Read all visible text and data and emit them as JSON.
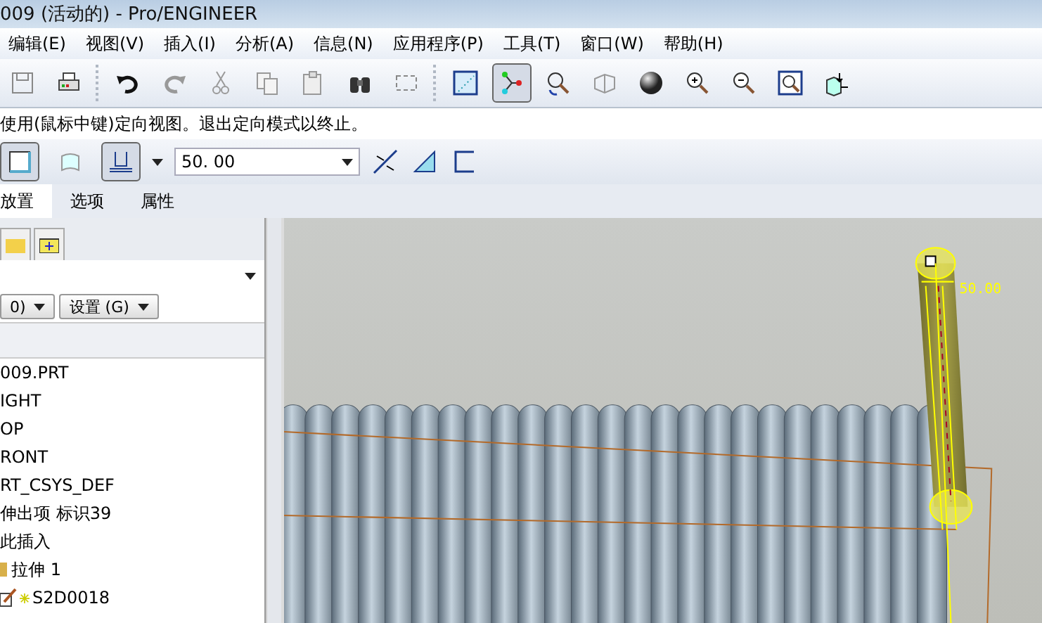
{
  "window": {
    "title": "009 (活动的) - Pro/ENGINEER"
  },
  "menu": [
    "编辑(E)",
    "视图(V)",
    "插入(I)",
    "分析(A)",
    "信息(N)",
    "应用程序(P)",
    "工具(T)",
    "窗口(W)",
    "帮助(H)"
  ],
  "toolbar": [
    [
      {
        "kind": "save"
      },
      {
        "kind": "print"
      }
    ],
    [
      {
        "kind": "undo"
      },
      {
        "kind": "redo"
      },
      {
        "kind": "cut"
      },
      {
        "kind": "copy"
      },
      {
        "kind": "paste"
      },
      {
        "kind": "find"
      },
      {
        "kind": "select"
      }
    ],
    [
      {
        "kind": "datum"
      },
      {
        "kind": "axes",
        "on": true
      },
      {
        "kind": "spin"
      },
      {
        "kind": "wire"
      },
      {
        "kind": "shade"
      },
      {
        "kind": "zoomin"
      },
      {
        "kind": "zoomout"
      },
      {
        "kind": "fit"
      },
      {
        "kind": "view"
      }
    ]
  ],
  "message": "使用(鼠标中键)定向视图。退出定向模式以终止。",
  "dashboard": {
    "solid_selected": true,
    "thicken_selected": false,
    "depth_selected": true,
    "depth_value": "50. 00"
  },
  "tabs": [
    {
      "label": "放置",
      "selected": true
    },
    {
      "label": "选项",
      "selected": false
    },
    {
      "label": "属性",
      "selected": false
    }
  ],
  "sidebar": {
    "buttons": [
      "0)",
      "设置 (G)"
    ],
    "tree": [
      {
        "label": "009.PRT",
        "children": [
          {
            "label": "IGHT"
          },
          {
            "label": "OP"
          },
          {
            "label": "RONT"
          },
          {
            "label": "RT_CSYS_DEF"
          },
          {
            "label": "伸出项 标识39"
          },
          {
            "label": "此插入"
          },
          {
            "label": "拉伸 1",
            "children": [
              {
                "label": "S2D0018"
              }
            ]
          }
        ]
      }
    ]
  },
  "viewport": {
    "dimension": "50.00"
  }
}
